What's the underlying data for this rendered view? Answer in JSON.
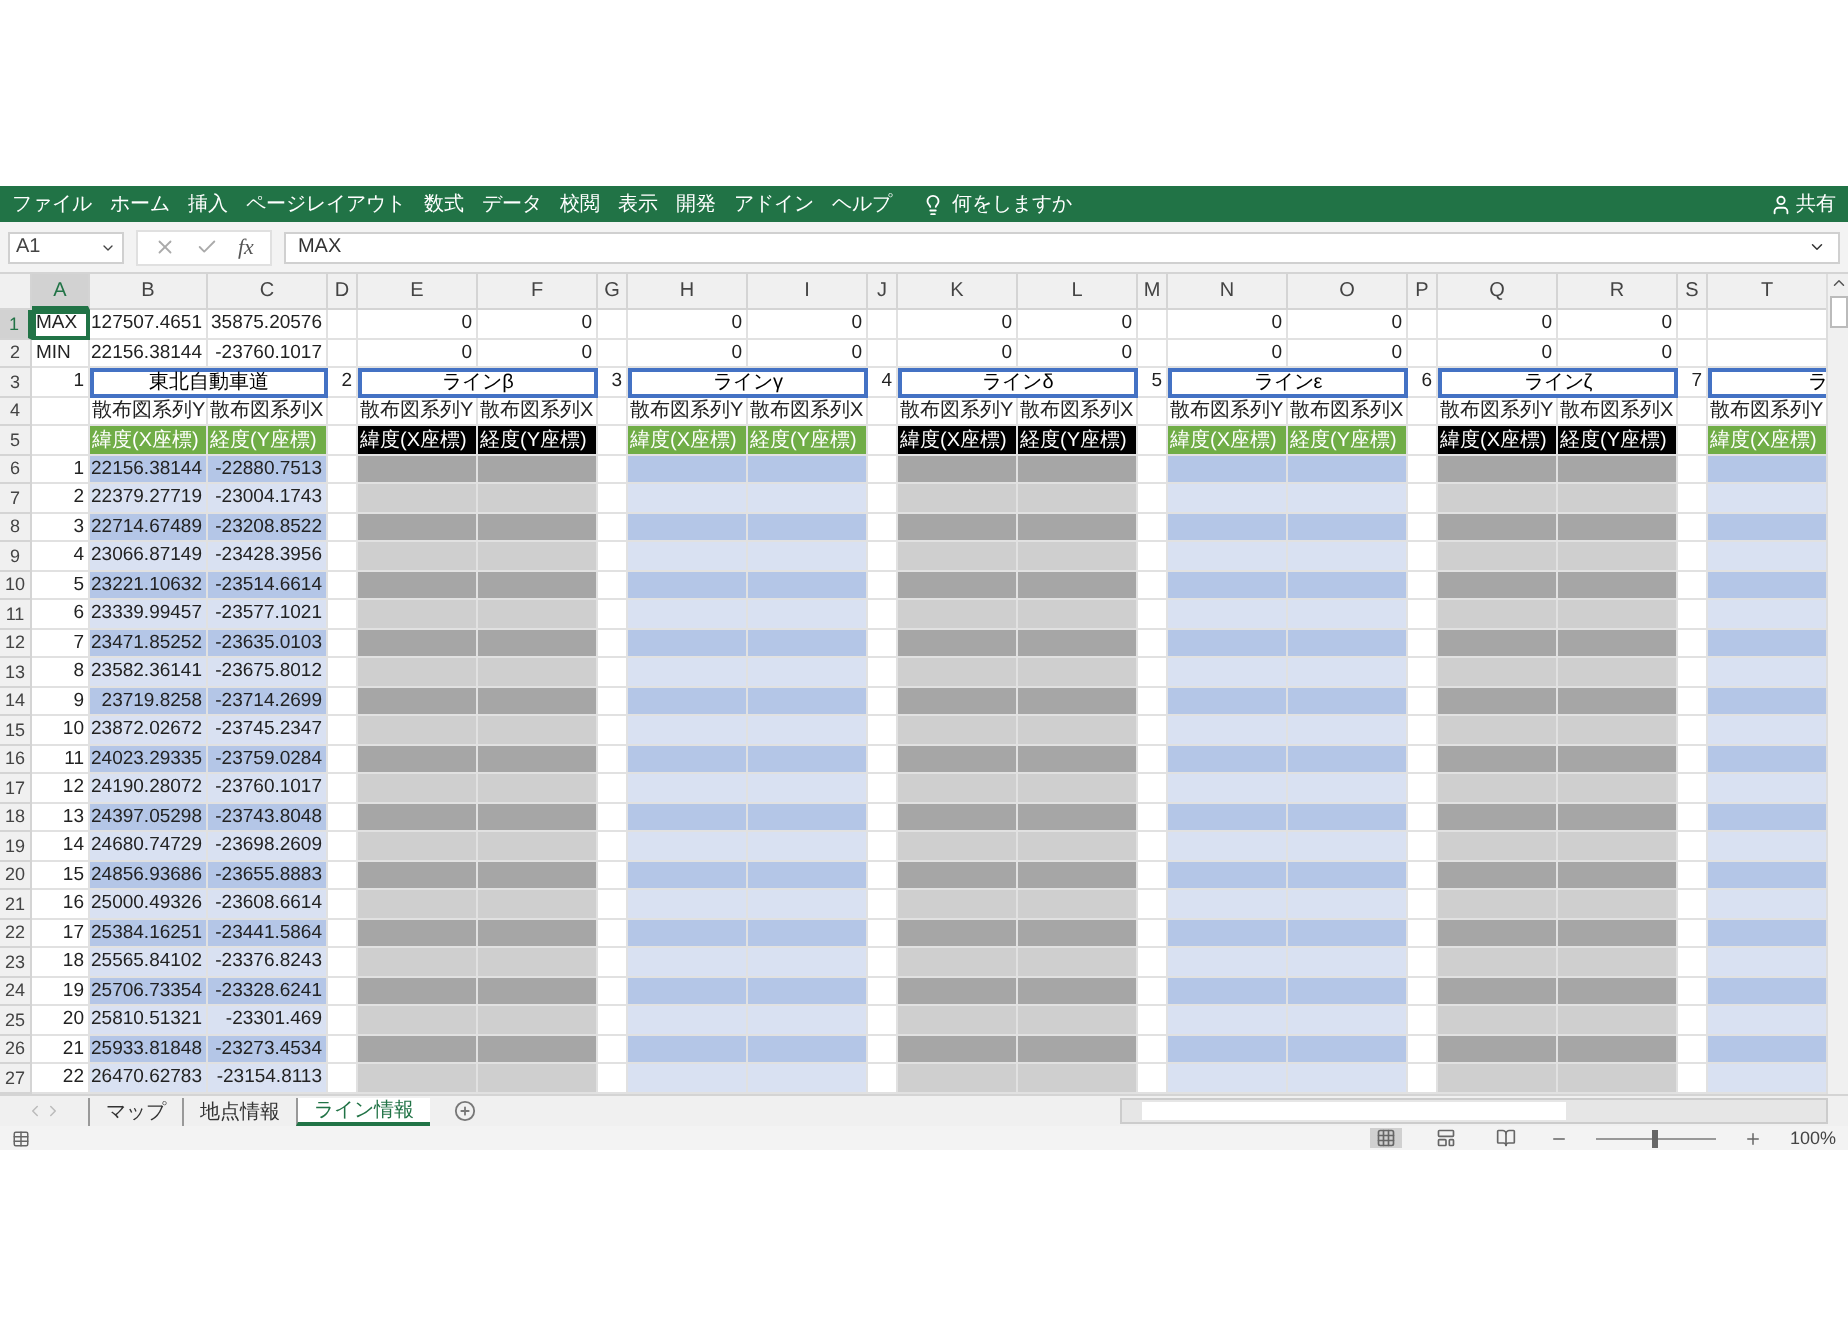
{
  "ribbon": {
    "tabs": [
      "ファイル",
      "ホーム",
      "挿入",
      "ページレイアウト",
      "数式",
      "データ",
      "校閲",
      "表示",
      "開発",
      "アドイン",
      "ヘルプ"
    ],
    "tell_me": "何をしますか",
    "share": "共有"
  },
  "formula_bar": {
    "name_box": "A1",
    "function_label": "fx",
    "formula": "MAX"
  },
  "columns": [
    {
      "label": "A",
      "selected": true
    },
    {
      "label": "B",
      "selected": false
    },
    {
      "label": "C",
      "selected": false
    },
    {
      "label": "D",
      "selected": false
    },
    {
      "label": "E",
      "selected": false
    },
    {
      "label": "F",
      "selected": false
    },
    {
      "label": "G",
      "selected": false
    },
    {
      "label": "H",
      "selected": false
    },
    {
      "label": "I",
      "selected": false
    },
    {
      "label": "J",
      "selected": false
    },
    {
      "label": "K",
      "selected": false
    },
    {
      "label": "L",
      "selected": false
    },
    {
      "label": "M",
      "selected": false
    },
    {
      "label": "N",
      "selected": false
    },
    {
      "label": "O",
      "selected": false
    },
    {
      "label": "P",
      "selected": false
    },
    {
      "label": "Q",
      "selected": false
    },
    {
      "label": "R",
      "selected": false
    },
    {
      "label": "S",
      "selected": false
    },
    {
      "label": "T",
      "selected": false
    }
  ],
  "row_headers": [
    {
      "label": "1",
      "selected": true
    },
    {
      "label": "2",
      "selected": false
    },
    {
      "label": "3",
      "selected": false
    },
    {
      "label": "4",
      "selected": false
    },
    {
      "label": "5",
      "selected": false
    },
    {
      "label": "6",
      "selected": false
    },
    {
      "label": "7",
      "selected": false
    },
    {
      "label": "8",
      "selected": false
    },
    {
      "label": "9",
      "selected": false
    },
    {
      "label": "10",
      "selected": false
    },
    {
      "label": "11",
      "selected": false
    },
    {
      "label": "12",
      "selected": false
    },
    {
      "label": "13",
      "selected": false
    },
    {
      "label": "14",
      "selected": false
    },
    {
      "label": "15",
      "selected": false
    },
    {
      "label": "16",
      "selected": false
    },
    {
      "label": "17",
      "selected": false
    },
    {
      "label": "18",
      "selected": false
    },
    {
      "label": "19",
      "selected": false
    },
    {
      "label": "20",
      "selected": false
    },
    {
      "label": "21",
      "selected": false
    },
    {
      "label": "22",
      "selected": false
    },
    {
      "label": "23",
      "selected": false
    },
    {
      "label": "24",
      "selected": false
    },
    {
      "label": "25",
      "selected": false
    },
    {
      "label": "26",
      "selected": false
    },
    {
      "label": "27",
      "selected": false
    }
  ],
  "row_labels": [
    "MAX",
    "MIN"
  ],
  "blocks": [
    {
      "number": "1",
      "title": "東北自動車道",
      "kind": "green",
      "series": [
        "散布図系列Y",
        "散布図系列X"
      ],
      "headers": [
        "緯度(X座標)",
        "経度(Y座標)"
      ],
      "summary": [
        [
          "127507.4651",
          "35875.20576"
        ],
        [
          "22156.38144",
          "-23760.1017"
        ]
      ],
      "rows": [
        [
          "1",
          "22156.38144",
          "-22880.7513"
        ],
        [
          "2",
          "22379.27719",
          "-23004.1743"
        ],
        [
          "3",
          "22714.67489",
          "-23208.8522"
        ],
        [
          "4",
          "23066.87149",
          "-23428.3956"
        ],
        [
          "5",
          "23221.10632",
          "-23514.6614"
        ],
        [
          "6",
          "23339.99457",
          "-23577.1021"
        ],
        [
          "7",
          "23471.85252",
          "-23635.0103"
        ],
        [
          "8",
          "23582.36141",
          "-23675.8012"
        ],
        [
          "9",
          "23719.8258",
          "-23714.2699"
        ],
        [
          "10",
          "23872.02672",
          "-23745.2347"
        ],
        [
          "11",
          "24023.29335",
          "-23759.0284"
        ],
        [
          "12",
          "24190.28072",
          "-23760.1017"
        ],
        [
          "13",
          "24397.05298",
          "-23743.8048"
        ],
        [
          "14",
          "24680.74729",
          "-23698.2609"
        ],
        [
          "15",
          "24856.93686",
          "-23655.8883"
        ],
        [
          "16",
          "25000.49326",
          "-23608.6614"
        ],
        [
          "17",
          "25384.16251",
          "-23441.5864"
        ],
        [
          "18",
          "25565.84102",
          "-23376.8243"
        ],
        [
          "19",
          "25706.73354",
          "-23328.6241"
        ],
        [
          "20",
          "25810.51321",
          "-23301.469"
        ],
        [
          "21",
          "25933.81848",
          "-23273.4534"
        ],
        [
          "22",
          "26470.62783",
          "-23154.8113"
        ]
      ]
    },
    {
      "number": "2",
      "title": "ラインβ",
      "kind": "black",
      "series": [
        "散布図系列Y",
        "散布図系列X"
      ],
      "headers": [
        "緯度(X座標)",
        "経度(Y座標)"
      ],
      "summary": [
        [
          "0",
          "0"
        ],
        [
          "0",
          "0"
        ]
      ]
    },
    {
      "number": "3",
      "title": "ラインγ",
      "kind": "green",
      "series": [
        "散布図系列Y",
        "散布図系列X"
      ],
      "headers": [
        "緯度(X座標)",
        "経度(Y座標)"
      ],
      "summary": [
        [
          "0",
          "0"
        ],
        [
          "0",
          "0"
        ]
      ]
    },
    {
      "number": "4",
      "title": "ラインδ",
      "kind": "black",
      "series": [
        "散布図系列Y",
        "散布図系列X"
      ],
      "headers": [
        "緯度(X座標)",
        "経度(Y座標)"
      ],
      "summary": [
        [
          "0",
          "0"
        ],
        [
          "0",
          "0"
        ]
      ]
    },
    {
      "number": "5",
      "title": "ラインε",
      "kind": "green",
      "series": [
        "散布図系列Y",
        "散布図系列X"
      ],
      "headers": [
        "緯度(X座標)",
        "経度(Y座標)"
      ],
      "summary": [
        [
          "0",
          "0"
        ],
        [
          "0",
          "0"
        ]
      ]
    },
    {
      "number": "6",
      "title": "ラインζ",
      "kind": "black",
      "series": [
        "散布図系列Y",
        "散布図系列X"
      ],
      "headers": [
        "緯度(X座標)",
        "経度(Y座標)"
      ],
      "summary": [
        [
          "0",
          "0"
        ],
        [
          "0",
          "0"
        ]
      ]
    },
    {
      "number": "7",
      "title": "ラ",
      "kind": "green",
      "series": [
        "散布図系列Y"
      ],
      "headers": [
        "緯度(X座標)"
      ]
    }
  ],
  "sheet_tabs": [
    {
      "label": "マップ",
      "selected": false
    },
    {
      "label": "地点情報",
      "selected": false
    },
    {
      "label": "ライン情報",
      "selected": true
    }
  ],
  "status_bar": {
    "zoom": "100%",
    "zoom_slider": {
      "level": 0.5
    }
  }
}
